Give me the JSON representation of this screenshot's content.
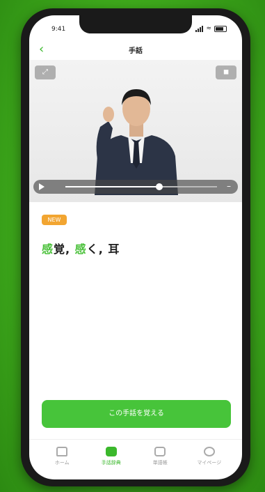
{
  "status": {
    "time": "9:41"
  },
  "nav": {
    "title": "手話"
  },
  "video": {
    "expand_icon": "expand-icon",
    "volume_icon": "volume-icon",
    "progress": 0.62
  },
  "card": {
    "badge": "NEW",
    "word": [
      {
        "text": "感",
        "highlight": true
      },
      {
        "text": "覚, ",
        "highlight": false
      },
      {
        "text": "感",
        "highlight": true
      },
      {
        "text": "く, 耳",
        "highlight": false
      }
    ]
  },
  "cta": {
    "label": "この手話を覚える"
  },
  "tabs": [
    {
      "label": "ホーム",
      "icon": "home-icon",
      "active": false
    },
    {
      "label": "手話辞典",
      "icon": "dictionary-icon",
      "active": true
    },
    {
      "label": "単語帳",
      "icon": "book-icon",
      "active": false
    },
    {
      "label": "マイページ",
      "icon": "profile-icon",
      "active": false
    }
  ],
  "colors": {
    "accent": "#47c43a",
    "badge": "#f2a531",
    "background": "#43b21e"
  }
}
